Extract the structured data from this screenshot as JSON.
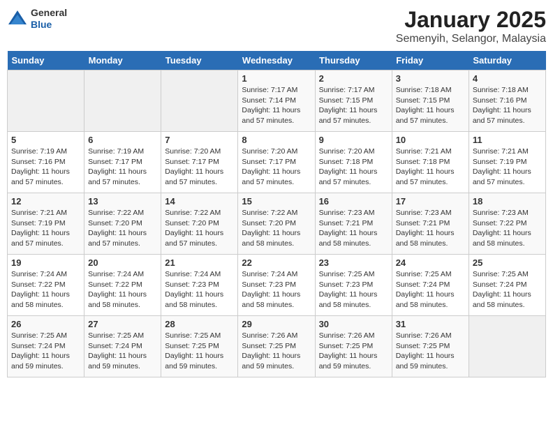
{
  "header": {
    "logo_general": "General",
    "logo_blue": "Blue",
    "title": "January 2025",
    "subtitle": "Semenyih, Selangor, Malaysia"
  },
  "weekdays": [
    "Sunday",
    "Monday",
    "Tuesday",
    "Wednesday",
    "Thursday",
    "Friday",
    "Saturday"
  ],
  "weeks": [
    [
      {
        "day": "",
        "sunrise": "",
        "sunset": "",
        "daylight": ""
      },
      {
        "day": "",
        "sunrise": "",
        "sunset": "",
        "daylight": ""
      },
      {
        "day": "",
        "sunrise": "",
        "sunset": "",
        "daylight": ""
      },
      {
        "day": "1",
        "sunrise": "Sunrise: 7:17 AM",
        "sunset": "Sunset: 7:14 PM",
        "daylight": "Daylight: 11 hours and 57 minutes."
      },
      {
        "day": "2",
        "sunrise": "Sunrise: 7:17 AM",
        "sunset": "Sunset: 7:15 PM",
        "daylight": "Daylight: 11 hours and 57 minutes."
      },
      {
        "day": "3",
        "sunrise": "Sunrise: 7:18 AM",
        "sunset": "Sunset: 7:15 PM",
        "daylight": "Daylight: 11 hours and 57 minutes."
      },
      {
        "day": "4",
        "sunrise": "Sunrise: 7:18 AM",
        "sunset": "Sunset: 7:16 PM",
        "daylight": "Daylight: 11 hours and 57 minutes."
      }
    ],
    [
      {
        "day": "5",
        "sunrise": "Sunrise: 7:19 AM",
        "sunset": "Sunset: 7:16 PM",
        "daylight": "Daylight: 11 hours and 57 minutes."
      },
      {
        "day": "6",
        "sunrise": "Sunrise: 7:19 AM",
        "sunset": "Sunset: 7:17 PM",
        "daylight": "Daylight: 11 hours and 57 minutes."
      },
      {
        "day": "7",
        "sunrise": "Sunrise: 7:20 AM",
        "sunset": "Sunset: 7:17 PM",
        "daylight": "Daylight: 11 hours and 57 minutes."
      },
      {
        "day": "8",
        "sunrise": "Sunrise: 7:20 AM",
        "sunset": "Sunset: 7:17 PM",
        "daylight": "Daylight: 11 hours and 57 minutes."
      },
      {
        "day": "9",
        "sunrise": "Sunrise: 7:20 AM",
        "sunset": "Sunset: 7:18 PM",
        "daylight": "Daylight: 11 hours and 57 minutes."
      },
      {
        "day": "10",
        "sunrise": "Sunrise: 7:21 AM",
        "sunset": "Sunset: 7:18 PM",
        "daylight": "Daylight: 11 hours and 57 minutes."
      },
      {
        "day": "11",
        "sunrise": "Sunrise: 7:21 AM",
        "sunset": "Sunset: 7:19 PM",
        "daylight": "Daylight: 11 hours and 57 minutes."
      }
    ],
    [
      {
        "day": "12",
        "sunrise": "Sunrise: 7:21 AM",
        "sunset": "Sunset: 7:19 PM",
        "daylight": "Daylight: 11 hours and 57 minutes."
      },
      {
        "day": "13",
        "sunrise": "Sunrise: 7:22 AM",
        "sunset": "Sunset: 7:20 PM",
        "daylight": "Daylight: 11 hours and 57 minutes."
      },
      {
        "day": "14",
        "sunrise": "Sunrise: 7:22 AM",
        "sunset": "Sunset: 7:20 PM",
        "daylight": "Daylight: 11 hours and 57 minutes."
      },
      {
        "day": "15",
        "sunrise": "Sunrise: 7:22 AM",
        "sunset": "Sunset: 7:20 PM",
        "daylight": "Daylight: 11 hours and 58 minutes."
      },
      {
        "day": "16",
        "sunrise": "Sunrise: 7:23 AM",
        "sunset": "Sunset: 7:21 PM",
        "daylight": "Daylight: 11 hours and 58 minutes."
      },
      {
        "day": "17",
        "sunrise": "Sunrise: 7:23 AM",
        "sunset": "Sunset: 7:21 PM",
        "daylight": "Daylight: 11 hours and 58 minutes."
      },
      {
        "day": "18",
        "sunrise": "Sunrise: 7:23 AM",
        "sunset": "Sunset: 7:22 PM",
        "daylight": "Daylight: 11 hours and 58 minutes."
      }
    ],
    [
      {
        "day": "19",
        "sunrise": "Sunrise: 7:24 AM",
        "sunset": "Sunset: 7:22 PM",
        "daylight": "Daylight: 11 hours and 58 minutes."
      },
      {
        "day": "20",
        "sunrise": "Sunrise: 7:24 AM",
        "sunset": "Sunset: 7:22 PM",
        "daylight": "Daylight: 11 hours and 58 minutes."
      },
      {
        "day": "21",
        "sunrise": "Sunrise: 7:24 AM",
        "sunset": "Sunset: 7:23 PM",
        "daylight": "Daylight: 11 hours and 58 minutes."
      },
      {
        "day": "22",
        "sunrise": "Sunrise: 7:24 AM",
        "sunset": "Sunset: 7:23 PM",
        "daylight": "Daylight: 11 hours and 58 minutes."
      },
      {
        "day": "23",
        "sunrise": "Sunrise: 7:25 AM",
        "sunset": "Sunset: 7:23 PM",
        "daylight": "Daylight: 11 hours and 58 minutes."
      },
      {
        "day": "24",
        "sunrise": "Sunrise: 7:25 AM",
        "sunset": "Sunset: 7:24 PM",
        "daylight": "Daylight: 11 hours and 58 minutes."
      },
      {
        "day": "25",
        "sunrise": "Sunrise: 7:25 AM",
        "sunset": "Sunset: 7:24 PM",
        "daylight": "Daylight: 11 hours and 58 minutes."
      }
    ],
    [
      {
        "day": "26",
        "sunrise": "Sunrise: 7:25 AM",
        "sunset": "Sunset: 7:24 PM",
        "daylight": "Daylight: 11 hours and 59 minutes."
      },
      {
        "day": "27",
        "sunrise": "Sunrise: 7:25 AM",
        "sunset": "Sunset: 7:24 PM",
        "daylight": "Daylight: 11 hours and 59 minutes."
      },
      {
        "day": "28",
        "sunrise": "Sunrise: 7:25 AM",
        "sunset": "Sunset: 7:25 PM",
        "daylight": "Daylight: 11 hours and 59 minutes."
      },
      {
        "day": "29",
        "sunrise": "Sunrise: 7:26 AM",
        "sunset": "Sunset: 7:25 PM",
        "daylight": "Daylight: 11 hours and 59 minutes."
      },
      {
        "day": "30",
        "sunrise": "Sunrise: 7:26 AM",
        "sunset": "Sunset: 7:25 PM",
        "daylight": "Daylight: 11 hours and 59 minutes."
      },
      {
        "day": "31",
        "sunrise": "Sunrise: 7:26 AM",
        "sunset": "Sunset: 7:25 PM",
        "daylight": "Daylight: 11 hours and 59 minutes."
      },
      {
        "day": "",
        "sunrise": "",
        "sunset": "",
        "daylight": ""
      }
    ]
  ]
}
